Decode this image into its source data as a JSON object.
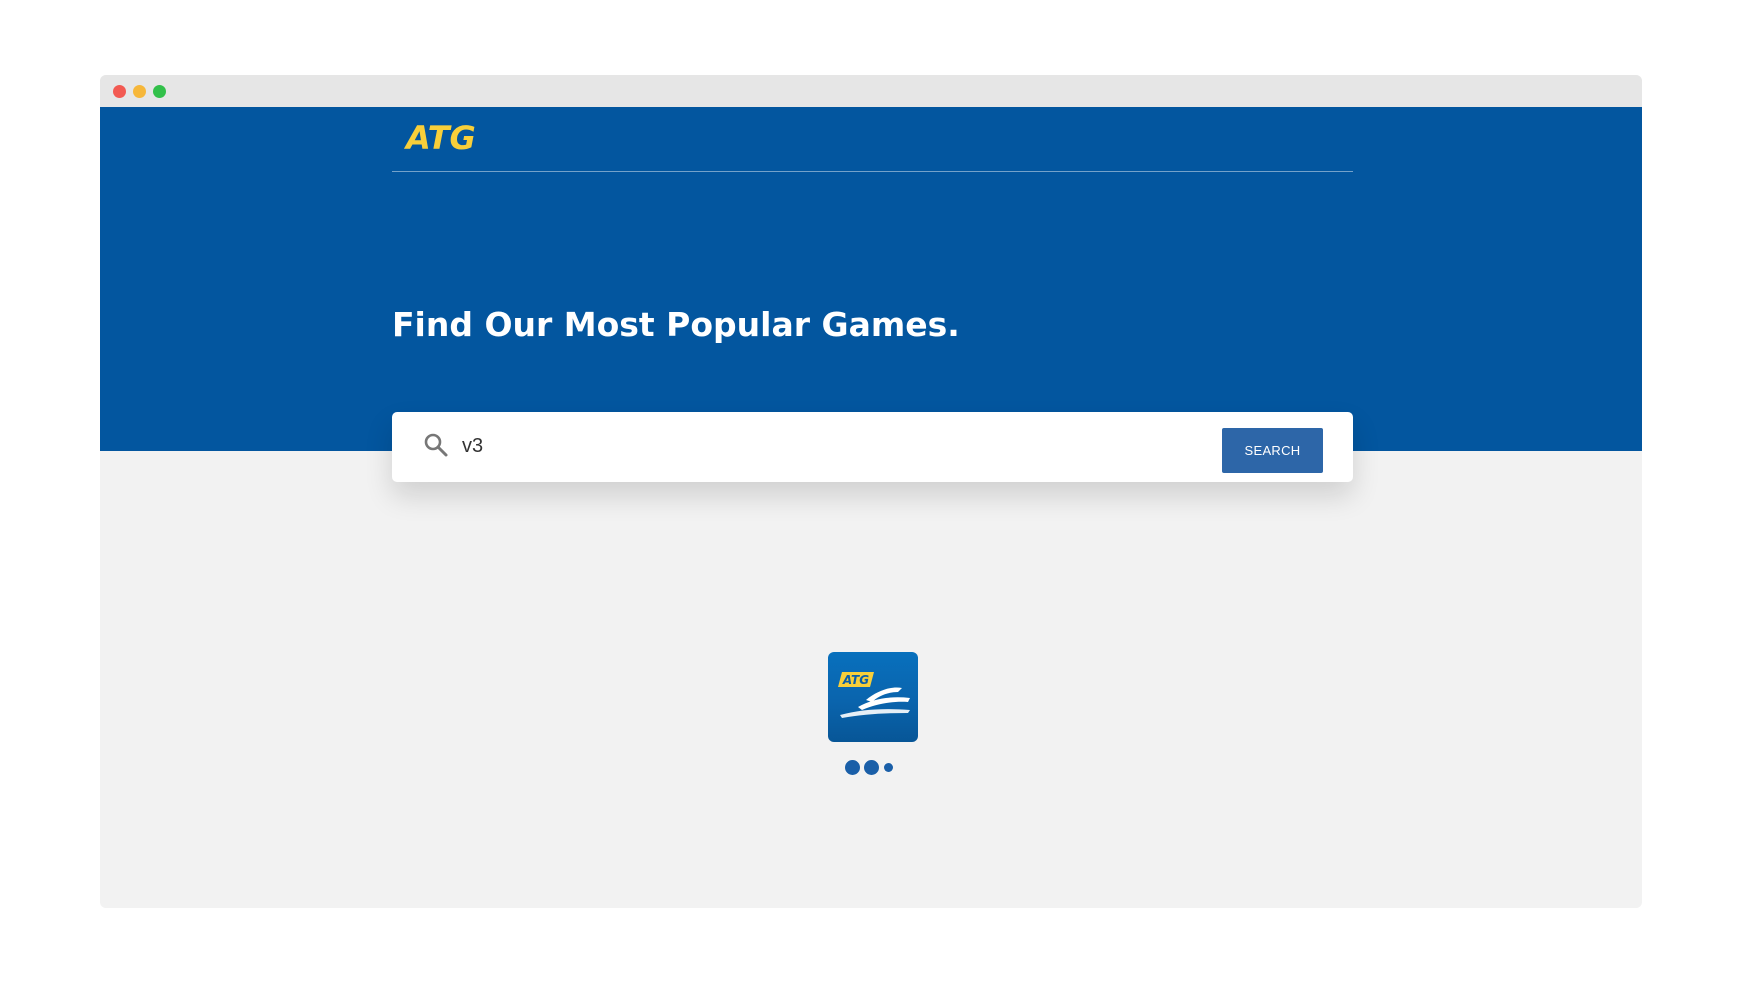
{
  "window": {
    "controls": [
      "close",
      "minimize",
      "maximize"
    ]
  },
  "header": {
    "logo_text": "ATG"
  },
  "hero": {
    "title": "Find Our Most Popular Games."
  },
  "search": {
    "icon": "search-icon",
    "value": "v3",
    "button_label": "SEARCH"
  },
  "app_tile": {
    "logo_text": "ATG",
    "icon": "horse-racing-icon"
  },
  "loader": {
    "dots": 3
  },
  "colors": {
    "hero_blue": "#03569f",
    "logo_yellow": "#f8cf3a",
    "button_blue": "#2d66a8",
    "page_bg": "#f2f2f2"
  }
}
